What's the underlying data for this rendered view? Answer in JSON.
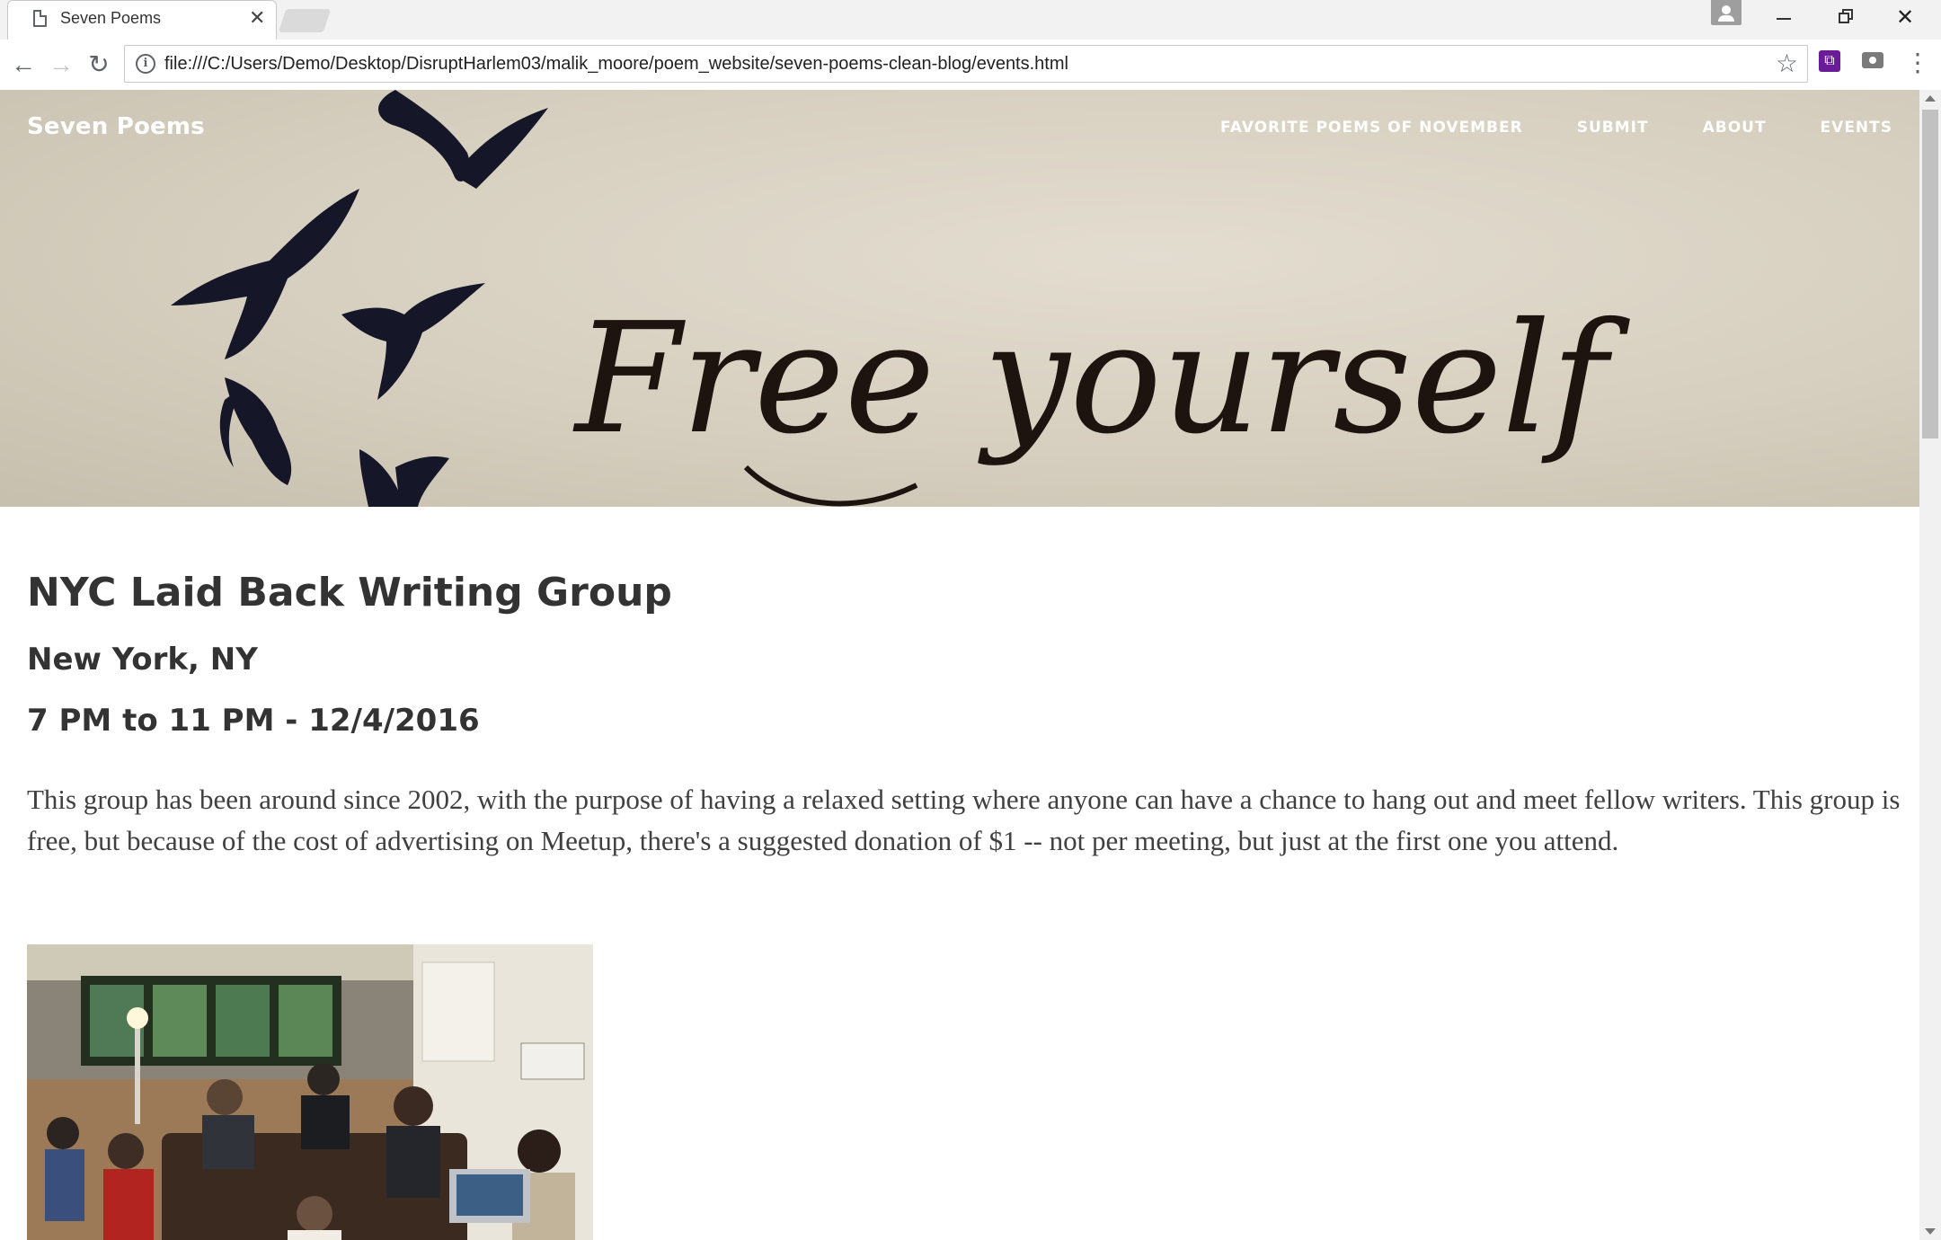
{
  "browser": {
    "tab_title": "Seven Poems",
    "url": "file:///C:/Users/Demo/Desktop/DisruptHarlem03/malik_moore/poem_website/seven-poems-clean-blog/events.html"
  },
  "site": {
    "brand": "Seven Poems",
    "nav": [
      "Favorite Poems of November",
      "Submit",
      "About",
      "Events"
    ],
    "hero_text": "Free yourself"
  },
  "event": {
    "title": "NYC Laid Back Writing Group",
    "location": "New York, NY",
    "time": "7 PM to 11 PM - 12/4/2016",
    "description": "This group has been around since 2002, with the purpose of having a relaxed setting where anyone can have a chance to hang out and meet fellow writers. This group is free, but because of the cost of advertising on Meetup, there's a suggested donation of $1 -- not per meeting, but just at the first one you attend."
  },
  "icons": {
    "tab": "document-icon",
    "close": "close-icon",
    "back": "back-arrow-icon",
    "forward": "forward-arrow-icon",
    "reload": "reload-icon",
    "info": "info-icon",
    "bookmark": "star-icon",
    "extension": "extension-icon",
    "camera": "camera-icon",
    "menu": "kebab-menu-icon"
  }
}
